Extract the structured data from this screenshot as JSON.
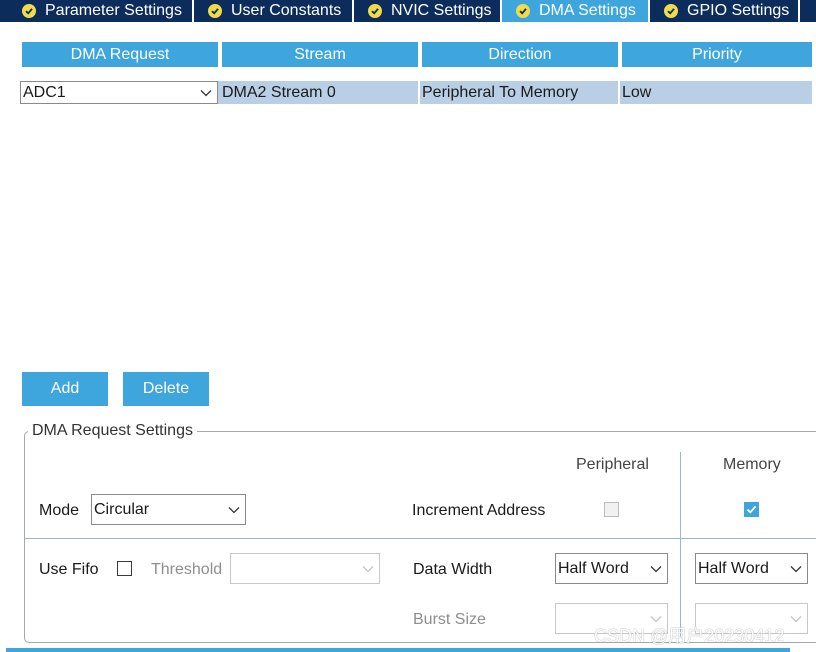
{
  "tabs": [
    {
      "label": "Parameter Settings",
      "active": false
    },
    {
      "label": "User Constants",
      "active": false
    },
    {
      "label": "NVIC Settings",
      "active": false
    },
    {
      "label": "DMA Settings",
      "active": true
    },
    {
      "label": "GPIO Settings",
      "active": false
    }
  ],
  "table": {
    "headers": [
      "DMA Request",
      "Stream",
      "Direction",
      "Priority"
    ],
    "rows": [
      {
        "request": "ADC1",
        "stream": "DMA2 Stream 0",
        "direction": "Peripheral To Memory",
        "priority": "Low"
      }
    ]
  },
  "buttons": {
    "add": "Add",
    "delete": "Delete"
  },
  "settings": {
    "legend": "DMA Request Settings",
    "peripheral_header": "Peripheral",
    "memory_header": "Memory",
    "mode_label": "Mode",
    "mode_value": "Circular",
    "increment_label": "Increment Address",
    "increment_peripheral_checked": false,
    "increment_memory_checked": true,
    "use_fifo_label": "Use Fifo",
    "use_fifo_checked": false,
    "threshold_label": "Threshold",
    "threshold_value": "",
    "data_width_label": "Data Width",
    "data_width_peripheral": "Half Word",
    "data_width_memory": "Half Word",
    "burst_size_label": "Burst Size",
    "burst_size_peripheral": "",
    "burst_size_memory": ""
  },
  "watermark": "CSDN @用户20230412",
  "colors": {
    "tab_bg": "#0c2d5c",
    "accent": "#3ea6dc",
    "row_selected": "#b9cfe6",
    "tab_check": "#f0dc4a"
  },
  "icons": {
    "tab_status": "check-circle-icon",
    "dropdown": "chevron-down-icon"
  }
}
